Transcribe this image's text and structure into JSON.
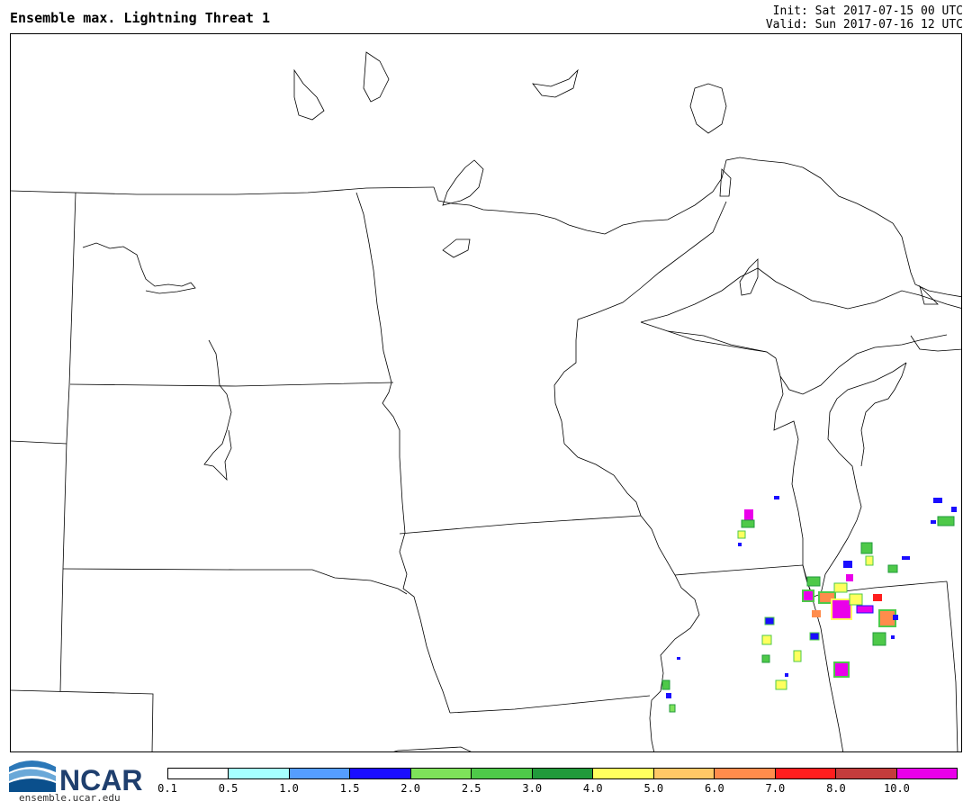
{
  "header": {
    "title": "Ensemble max. Lightning Threat 1",
    "init": "Init: Sat 2017-07-15 00 UTC",
    "valid": "Valid: Sun 2017-07-16 12 UTC"
  },
  "logo": {
    "name": "NCAR",
    "url": "ensemble.ucar.edu"
  },
  "colorbar": {
    "ticks": [
      "0.1",
      "0.5",
      "1.0",
      "1.5",
      "2.0",
      "2.5",
      "3.0",
      "4.0",
      "5.0",
      "6.0",
      "7.0",
      "8.0",
      "10.0"
    ],
    "colors": [
      "#ffffff",
      "#a6ffff",
      "#559dff",
      "#1a0dff",
      "#7ee25a",
      "#4ec949",
      "#219a3b",
      "#ffff5e",
      "#ffc866",
      "#ff8c4c",
      "#ff1e1e",
      "#c43c3c",
      "#ea00ea"
    ]
  },
  "map": {
    "features": "state-boundaries-great-lakes-region",
    "shaded_cells": "lightning-threat-ensemble-max"
  }
}
